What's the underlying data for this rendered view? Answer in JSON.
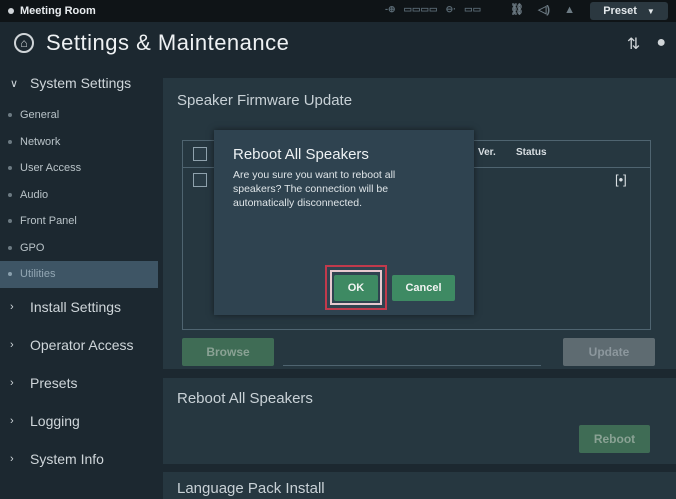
{
  "topbar": {
    "room_name": "Meeting Room",
    "preset_label": "Preset"
  },
  "header": {
    "title": "Settings & Maintenance"
  },
  "sidebar": {
    "system_settings": {
      "label": "System Settings",
      "items": [
        {
          "label": "General"
        },
        {
          "label": "Network"
        },
        {
          "label": "User Access"
        },
        {
          "label": "Audio"
        },
        {
          "label": "Front Panel"
        },
        {
          "label": "GPO"
        },
        {
          "label": "Utilities"
        }
      ]
    },
    "sections": [
      {
        "label": "Install Settings"
      },
      {
        "label": "Operator Access"
      },
      {
        "label": "Presets"
      },
      {
        "label": "Logging"
      },
      {
        "label": "System Info"
      }
    ]
  },
  "firmware_card": {
    "title": "Speaker Firmware Update",
    "columns": {
      "ver": "Ver.",
      "status": "Status"
    },
    "browse_label": "Browse",
    "update_label": "Update"
  },
  "reboot_card": {
    "title": "Reboot All Speakers",
    "reboot_label": "Reboot"
  },
  "language_card": {
    "title": "Language Pack Install"
  },
  "dialog": {
    "title": "Reboot All Speakers",
    "body": "Are you sure you want to reboot all speakers? The connection will be automatically disconnected.",
    "ok_label": "OK",
    "cancel_label": "Cancel"
  },
  "colors": {
    "accent_green": "#3e8a63",
    "highlight_frame": "#c13a4c"
  }
}
